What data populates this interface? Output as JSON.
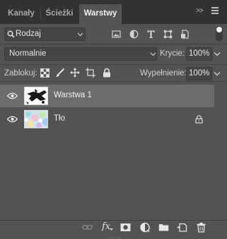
{
  "tabs": [
    {
      "label": "Kanały",
      "active": false
    },
    {
      "label": "Ścieżki",
      "active": false
    },
    {
      "label": "Warstwy",
      "active": true
    }
  ],
  "panel_controls": {
    "collapse_label": ">>",
    "menu_icon": "hamburger-menu-icon"
  },
  "filter": {
    "kind_label": "Rodzaj",
    "icons": [
      "image-filter-icon",
      "adjustment-filter-icon",
      "type-filter-icon",
      "shape-filter-icon",
      "smart-object-filter-icon"
    ],
    "filter_toggle": "on"
  },
  "blend": {
    "mode_label": "Normalnie",
    "opacity_label": "Krycie:",
    "opacity_value": "100%"
  },
  "lock_row": {
    "lock_label": "Zablokuj:",
    "lock_icons": [
      "lock-transparent-pixels-icon",
      "lock-image-pixels-icon",
      "lock-position-icon",
      "artboard-autonest-icon",
      "lock-all-icon"
    ],
    "fill_label": "Wypełnienie:",
    "fill_value": "100%"
  },
  "layers": [
    {
      "name": "Warstwa 1",
      "visible": true,
      "selected": true,
      "locked": false
    },
    {
      "name": "Tło",
      "visible": true,
      "selected": false,
      "locked": true
    }
  ],
  "bottom_icons": [
    "link-layers-icon",
    "fx-layer-style-icon",
    "add-mask-icon",
    "adjustment-layer-icon",
    "new-group-icon",
    "new-layer-icon",
    "delete-layer-icon"
  ],
  "bottom_fx_label": "fx",
  "colors": {
    "panel_bg": "#535353",
    "tab_bar_bg": "#323232",
    "selected_layer_bg": "#6c6c6c",
    "field_bg": "#454545"
  }
}
